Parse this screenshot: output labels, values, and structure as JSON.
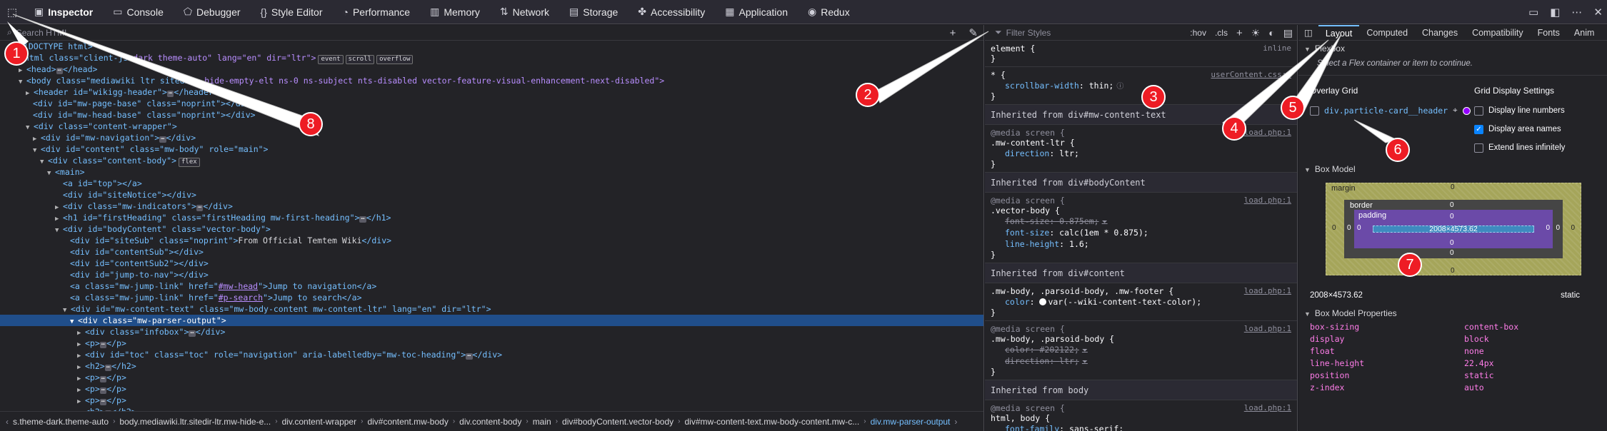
{
  "toolbar": {
    "tabs": [
      {
        "label": "Inspector",
        "icon": "inspector-icon",
        "glyph": "▣"
      },
      {
        "label": "Console",
        "icon": "console-icon",
        "glyph": "▭"
      },
      {
        "label": "Debugger",
        "icon": "debugger-icon",
        "glyph": "⬠"
      },
      {
        "label": "Style Editor",
        "icon": "style-editor-icon",
        "glyph": "{}"
      },
      {
        "label": "Performance",
        "icon": "performance-icon",
        "glyph": "◔"
      },
      {
        "label": "Memory",
        "icon": "memory-icon",
        "glyph": "▥"
      },
      {
        "label": "Network",
        "icon": "network-icon",
        "glyph": "⇅"
      },
      {
        "label": "Storage",
        "icon": "storage-icon",
        "glyph": "▤"
      },
      {
        "label": "Accessibility",
        "icon": "accessibility-icon",
        "glyph": "✤"
      },
      {
        "label": "Application",
        "icon": "application-icon",
        "glyph": "▦"
      },
      {
        "label": "Redux",
        "icon": "redux-icon",
        "glyph": "◉"
      }
    ]
  },
  "markup": {
    "search_placeholder": "Search HTML",
    "breadcrumbs": [
      "s.theme-dark.theme-auto",
      "body.mediawiki.ltr.sitedir-ltr.mw-hide-e...",
      "div.content-wrapper",
      "div#content.mw-body",
      "div.content-body",
      "main",
      "div#bodyContent.vector-body",
      "div#mw-content-text.mw-body-content.mw-c...",
      "div.mw-parser-output"
    ],
    "badges": {
      "event": "event",
      "scroll": "scroll",
      "overflow": "overflow",
      "flex": "flex"
    },
    "frags": {
      "doctype": "<!DOCTYPE html>",
      "html_a": "<html class=\"client-js",
      "html_b": "dark theme-auto\" lang=\"en\" dir=\"ltr\">",
      "head": "<head>",
      "head_end": "</head>",
      "body_a": "<body class=\"mediawiki ltr sitedir",
      "body_b": "-hide-empty-elt ns-0 ns-subject",
      "body_c": "nts-disabled vector-feature-visual-enhancement-next-disabled\">",
      "header": "<header id=\"wikigg-header\">",
      "header_end": "</header>",
      "page_base": "<div id=\"mw-page-base\" class=\"noprint\"></div>",
      "head_base": "<div id=\"mw-head-base\" class=\"noprint\"></div>",
      "content_wrapper": "<div class=\"content-wrapper\">",
      "mw_navigation": "<div id=\"mw-navigation\">",
      "div_end": "</div>",
      "content": "<div id=\"content\" class=\"mw-body\" role=\"main\">",
      "content_body": "<div class=\"content-body\">",
      "main": "<main>",
      "top": "<a id=\"top\"></a>",
      "site_notice": "<div id=\"siteNotice\"></div>",
      "indicators": "<div class=\"mw-indicators\">",
      "h1": "<h1 id=\"firstHeading\" class=\"firstHeading mw-first-heading\">",
      "h1_end": "</h1>",
      "body_content": "<div id=\"bodyContent\" class=\"vector-body\">",
      "site_sub": "<div id=\"siteSub\" class=\"noprint\">",
      "site_sub_text": "From Official Temtem Wiki",
      "content_sub": "<div id=\"contentSub\"></div>",
      "content_sub2": "<div id=\"contentSub2\"></div>",
      "jump_to_nav": "<div id=\"jump-to-nav\"></div>",
      "jump1_a": "<a class=\"mw-jump-link\" href=\"",
      "jump1_href": "#mw-head",
      "jump1_b": "\">Jump to navigation</a>",
      "jump2_href": "#p-search",
      "jump2_b": "\">Jump to search</a>",
      "content_text": "<div id=\"mw-content-text\" class=\"mw-body-content mw-content-ltr\" lang=\"en\" dir=\"ltr\">",
      "parser_output": "<div class=\"mw-parser-output\">",
      "infobox": "<div class=\"infobox\">",
      "p": "<p>",
      "p_end": "</p>",
      "toc": "<div id=\"toc\" class=\"toc\" role=\"navigation\" aria-labelledby=\"mw-toc-heading\">",
      "h2": "<h2>",
      "h2_end": "</h2>"
    }
  },
  "rules": {
    "filter_placeholder": "Filter Styles",
    "hov": ":hov",
    "cls": ".cls",
    "element_rule": {
      "selector": "element {",
      "origin": "inline",
      "close": "}"
    },
    "star_rule": {
      "selector": "* {",
      "source": "userContent.css:1",
      "prop": "scrollbar-width",
      "value": "thin;"
    },
    "inherited_1": "Inherited from div#mw-content-text",
    "rule1": {
      "media": "@media screen {",
      "selector": ".mw-content-ltr {",
      "source": "load.php:1",
      "prop": "direction",
      "value": "ltr;"
    },
    "inherited_2": "Inherited from div#bodyContent",
    "rule2": {
      "media": "@media screen {",
      "selector": ".vector-body {",
      "source": "load.php:1",
      "p1": "font-size",
      "v1": "0.875em;",
      "p2": "font-size",
      "v2": "calc(1em * 0.875);",
      "p3": "line-height",
      "v3": "1.6;"
    },
    "inherited_3": "Inherited from div#content",
    "rule3": {
      "selector": ".mw-body, .parsoid-body, .mw-footer {",
      "source": "load.php:1",
      "prop": "color",
      "value": "var(--wiki-content-text-color);"
    },
    "rule4": {
      "media": "@media screen {",
      "selector": ".mw-body, .parsoid-body {",
      "source": "load.php:1",
      "p1": "color",
      "v1": "#202122;",
      "p2": "direction",
      "v2": "ltr;"
    },
    "inherited_4": "Inherited from body",
    "rule5": {
      "media": "@media screen {",
      "selector": "html, body {",
      "source": "load.php:1",
      "prop": "font-family",
      "value": "sans-serif",
      "semi": ";"
    },
    "close": "}"
  },
  "layout": {
    "tabs": [
      "Layout",
      "Computed",
      "Changes",
      "Compatibility",
      "Fonts",
      "Anim"
    ],
    "flexbox_title": "Flexbox",
    "flexbox_hint": "Select a Flex container or item to continue.",
    "overlay_grid_title": "Overlay Grid",
    "grid_item": "div.particle-card__header",
    "grid_display_title": "Grid Display Settings",
    "settings": [
      {
        "label": "Display line numbers",
        "checked": false
      },
      {
        "label": "Display area names",
        "checked": true
      },
      {
        "label": "Extend lines infinitely",
        "checked": false
      }
    ],
    "box_model_title": "Box Model",
    "box": {
      "margin": "margin",
      "border": "border",
      "padding": "padding",
      "content": "2008×4573.62",
      "zero": "0"
    },
    "dims": "2008×4573.62",
    "position_value": "static",
    "props_title": "Box Model Properties",
    "props": [
      {
        "k": "box-sizing",
        "v": "content-box"
      },
      {
        "k": "display",
        "v": "block"
      },
      {
        "k": "float",
        "v": "none"
      },
      {
        "k": "line-height",
        "v": "22.4px"
      },
      {
        "k": "position",
        "v": "static"
      },
      {
        "k": "z-index",
        "v": "auto"
      }
    ]
  },
  "annotations": [
    "1",
    "2",
    "3",
    "4",
    "5",
    "6",
    "7",
    "8"
  ],
  "colors": {
    "accent": "#0a84ff",
    "callout": "#ee1c24",
    "selection": "#204e8a"
  }
}
